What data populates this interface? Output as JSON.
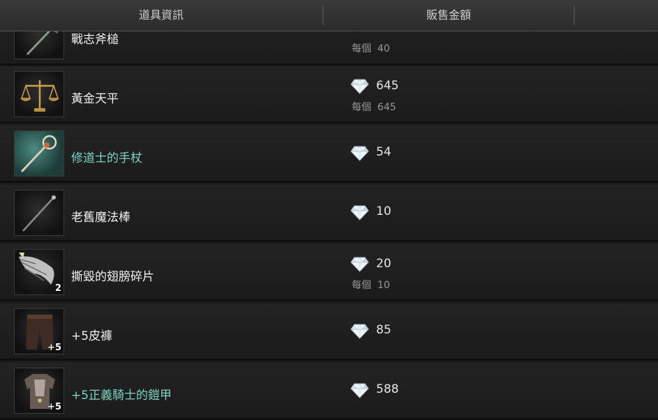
{
  "header": {
    "item_info": "道具資訊",
    "sell_price": "販售金額"
  },
  "rows": [
    {
      "name": "戰志斧槌",
      "price": "",
      "each_label": "每個",
      "each_value": "40",
      "icon": "axe-icon"
    },
    {
      "name": "黃金天平",
      "price": "645",
      "each_label": "每個",
      "each_value": "645",
      "icon": "golden-scale-icon"
    },
    {
      "name": "修道士的手杖",
      "price": "54",
      "icon": "monk-staff-icon"
    },
    {
      "name": "老舊魔法棒",
      "price": "10",
      "icon": "old-wand-icon"
    },
    {
      "name": "撕毀的翅膀碎片",
      "price": "20",
      "each_label": "每個",
      "each_value": "10",
      "count": "2",
      "icon": "torn-wing-icon"
    },
    {
      "name": "+5皮褲",
      "price": "85",
      "count": "+5",
      "icon": "leather-pants-icon"
    },
    {
      "name": "+5正義騎士的鎧甲",
      "price": "588",
      "count": "+5",
      "icon": "knight-armor-icon"
    }
  ],
  "colors": {
    "rare_name": "#7fd3c3",
    "normal_name": "#f0f0f0"
  }
}
